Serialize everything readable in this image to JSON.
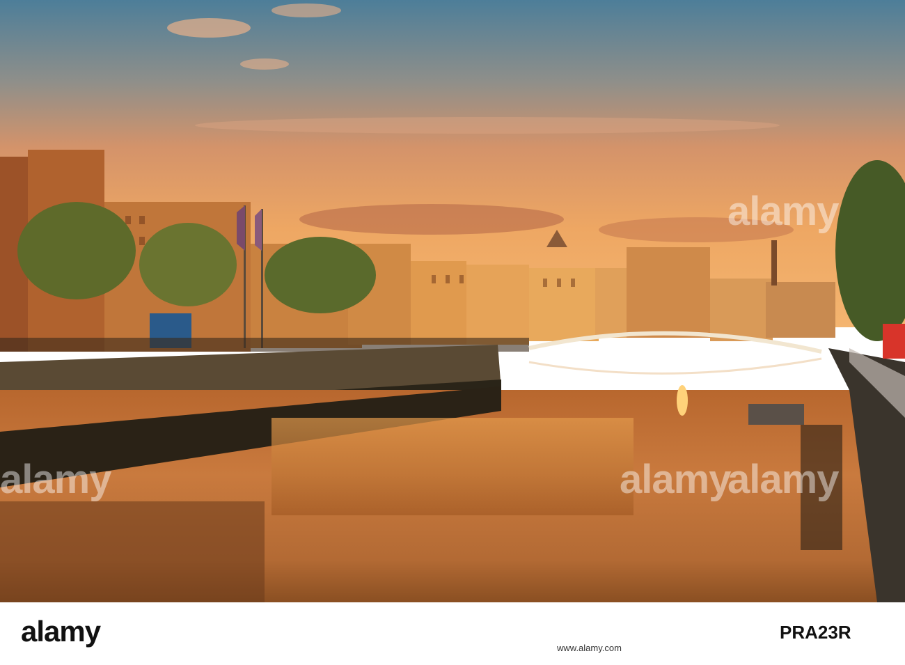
{
  "photo": {
    "subject": "sunset-cityscape-river-reflection",
    "colors": {
      "sky_top": "#4f7f9a",
      "sky_mid": "#d79266",
      "sky_glow": "#f2a55a",
      "water": "#c9733a",
      "wall": "#4a3a28"
    }
  },
  "watermark": {
    "text": "alamy"
  },
  "footer": {
    "brand": "alamy",
    "image_id": "PRA23R",
    "meta": "www.alamy.com"
  }
}
